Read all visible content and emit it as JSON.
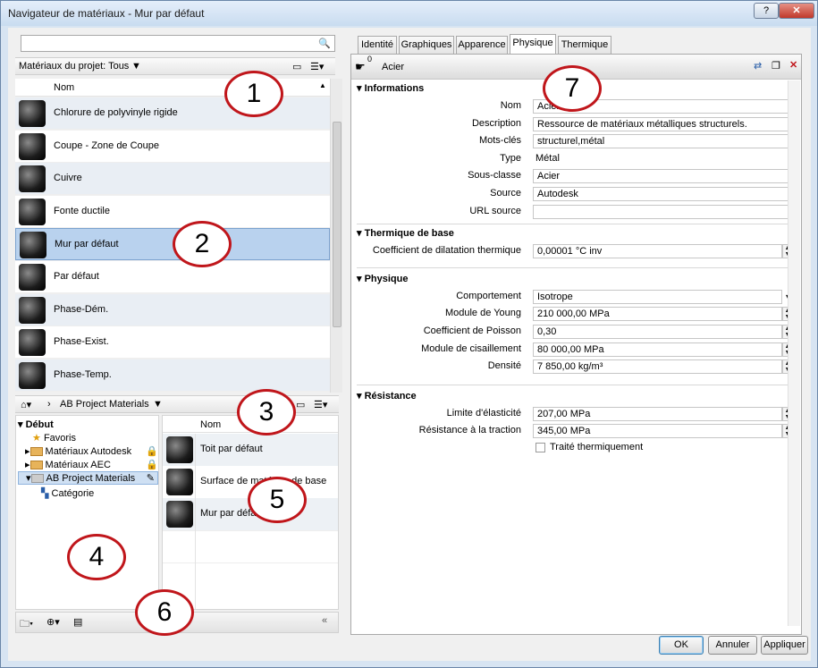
{
  "window": {
    "title": "Navigateur de matériaux - Mur par défaut",
    "help_label": "?",
    "close_label": "✕"
  },
  "library_top": {
    "search_placeholder": "",
    "filter_label": "Matériaux du projet: Tous",
    "column_header": "Nom",
    "materials": [
      "Chlorure de polyvinyle rigide",
      "Coupe - Zone de Coupe",
      "Cuivre",
      "Fonte ductile",
      "Mur par défaut",
      "Par défaut",
      "Phase-Dém.",
      "Phase-Exist.",
      "Phase-Temp."
    ],
    "selected_index": 4
  },
  "library_bottom": {
    "crumb_label": "AB Project Materials",
    "tree": [
      {
        "label": "Début"
      },
      {
        "label": "Favoris"
      },
      {
        "label": "Matériaux Autodesk"
      },
      {
        "label": "Matériaux AEC"
      },
      {
        "label": "AB Project Materials"
      },
      {
        "label": "Catégorie"
      }
    ],
    "column_header": "Nom",
    "items": [
      "Toit par défaut",
      "Surface de matériau de base",
      "Mur par défaut"
    ]
  },
  "callouts": [
    "1",
    "2",
    "3",
    "4",
    "5",
    "6",
    "7"
  ],
  "tabs": [
    "Identité",
    "Graphiques",
    "Apparence",
    "Physique",
    "Thermique"
  ],
  "active_tab": "Physique",
  "asset": {
    "name": "Acier",
    "count": "0"
  },
  "sections": {
    "info": {
      "title": "Informations",
      "rows": [
        {
          "label": "Nom",
          "value": "Acier"
        },
        {
          "label": "Description",
          "value": "Ressource de matériaux métalliques structurels."
        },
        {
          "label": "Mots-clés",
          "value": "structurel,métal"
        },
        {
          "label": "Type",
          "value": "Métal"
        },
        {
          "label": "Sous-classe",
          "value": "Acier"
        },
        {
          "label": "Source",
          "value": "Autodesk"
        },
        {
          "label": "URL source",
          "value": ""
        }
      ]
    },
    "thermal_base": {
      "title": "Thermique de base",
      "rows": [
        {
          "label": "Coefficient de dilatation thermique",
          "value": "0,00001 °C inv"
        }
      ]
    },
    "physical": {
      "title": "Physique",
      "rows": [
        {
          "label": "Comportement",
          "value": "Isotrope"
        },
        {
          "label": "Module de Young",
          "value": "210 000,00 MPa"
        },
        {
          "label": "Coefficient de Poisson",
          "value": "0,30"
        },
        {
          "label": "Module de cisaillement",
          "value": "80 000,00 MPa"
        },
        {
          "label": "Densité",
          "value": "7 850,00 kg/m³"
        }
      ]
    },
    "resistance": {
      "title": "Résistance",
      "rows": [
        {
          "label": "Limite d'élasticité",
          "value": "207,00 MPa"
        },
        {
          "label": "Résistance à la traction",
          "value": "345,00 MPa"
        }
      ],
      "checkbox_label": "Traité thermiquement"
    }
  },
  "buttons": {
    "ok": "OK",
    "cancel": "Annuler",
    "apply": "Appliquer"
  }
}
